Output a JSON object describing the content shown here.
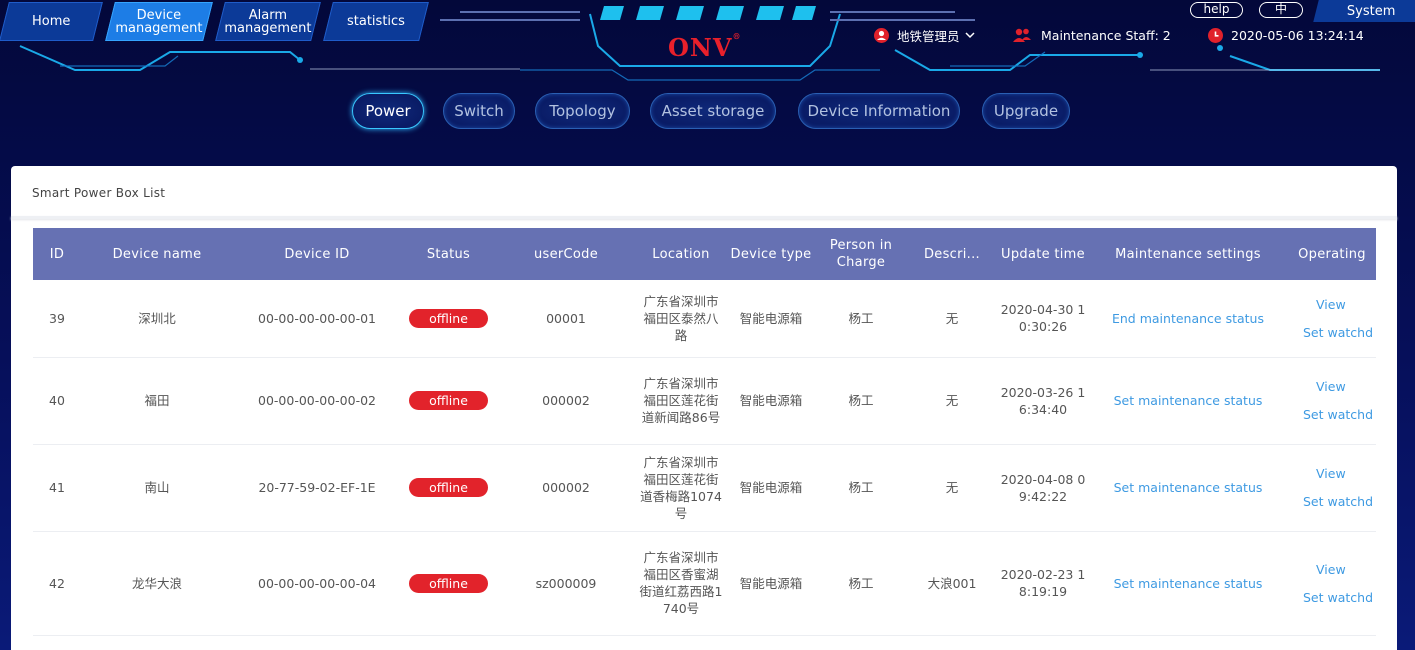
{
  "colors": {
    "accent": "#1d7de6",
    "header_bg": "#6671b3",
    "status_offline": "#e2232b",
    "link": "#3e9ae2"
  },
  "nav": {
    "tabs": [
      {
        "label": "Home"
      },
      {
        "label": "Device management",
        "active": true
      },
      {
        "label": "Alarm management"
      },
      {
        "label": "statistics"
      }
    ]
  },
  "logo": {
    "text": "ONV",
    "mark": "®"
  },
  "header_right": {
    "help_label": "help",
    "lang_label": "中",
    "system_label": "System",
    "user": {
      "icon": "user-icon",
      "name": "地铁管理员"
    },
    "staff": {
      "icon": "staff-icon",
      "label": "Maintenance Staff: 2"
    },
    "datetime": {
      "icon": "clock-icon",
      "value": "2020-05-06 13:24:14"
    }
  },
  "subtabs": [
    {
      "label": "Power",
      "active": true
    },
    {
      "label": "Switch"
    },
    {
      "label": "Topology"
    },
    {
      "label": "Asset storage"
    },
    {
      "label": "Device Information"
    },
    {
      "label": "Upgrade"
    }
  ],
  "panel": {
    "title": "Smart Power Box List"
  },
  "table": {
    "columns": [
      "ID",
      "Device name",
      "Device ID",
      "Status",
      "userCode",
      "Location",
      "Device type",
      "Person in Charge",
      "Descri...",
      "Update time",
      "Maintenance settings",
      "Operating"
    ],
    "rows": [
      {
        "id": "39",
        "name": "深圳北",
        "device_id": "00-00-00-00-00-01",
        "status": "offline",
        "user_code": "00001",
        "location": "广东省深圳市福田区泰然八路",
        "type": "智能电源箱",
        "person": "杨工",
        "desc": "无",
        "update_time": "2020-04-30 10:30:26",
        "maintenance": "End maintenance status",
        "view": "View",
        "watchdog": "Set watchd"
      },
      {
        "id": "40",
        "name": "福田",
        "device_id": "00-00-00-00-00-02",
        "status": "offline",
        "user_code": "000002",
        "location": "广东省深圳市福田区莲花街道新闻路86号",
        "type": "智能电源箱",
        "person": "杨工",
        "desc": "无",
        "update_time": "2020-03-26 16:34:40",
        "maintenance": "Set maintenance status",
        "view": "View",
        "watchdog": "Set watchd"
      },
      {
        "id": "41",
        "name": "南山",
        "device_id": "20-77-59-02-EF-1E",
        "status": "offline",
        "user_code": "000002",
        "location": "广东省深圳市福田区莲花街道香梅路1074号",
        "type": "智能电源箱",
        "person": "杨工",
        "desc": "无",
        "update_time": "2020-04-08 09:42:22",
        "maintenance": "Set maintenance status",
        "view": "View",
        "watchdog": "Set watchd"
      },
      {
        "id": "42",
        "name": "龙华大浪",
        "device_id": "00-00-00-00-00-04",
        "status": "offline",
        "user_code": "sz000009",
        "location": "广东省深圳市福田区香蜜湖街道红荔西路1740号",
        "type": "智能电源箱",
        "person": "杨工",
        "desc": "大浪001",
        "update_time": "2020-02-23 18:19:19",
        "maintenance": "Set maintenance status",
        "view": "View",
        "watchdog": "Set watchd"
      }
    ]
  }
}
